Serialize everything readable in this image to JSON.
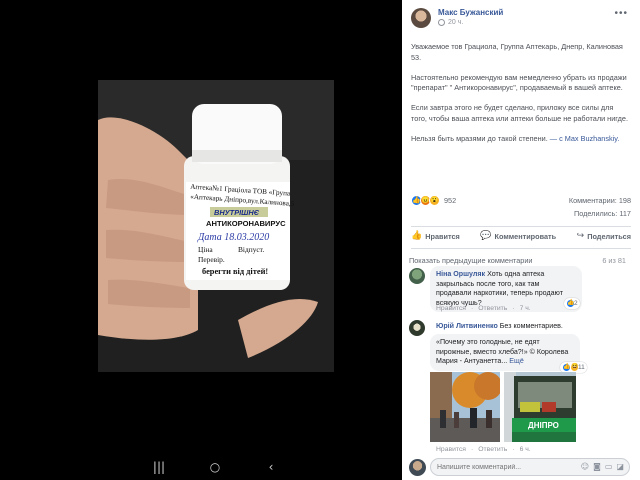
{
  "photo": {
    "label_lines": [
      "Аптека№1 Граціола ТОВ «Група",
      "«Аптекарь Дніпро,вул.Калинова,5",
      "ВНУТРІШНЄ",
      "АНТИКОРОНАВИРУС",
      "Дата 18.03.2020",
      "Ціна",
      "Відпуст.",
      "Перевір.",
      "берегти від дітей!"
    ]
  },
  "android_nav": {
    "recent": "|||",
    "home": "○",
    "back": "‹"
  },
  "post": {
    "author": "Макс Бужанский",
    "time": "20 ч.",
    "more": "•••",
    "paragraphs": [
      "Уважаемое тов Грациола, Группа Аптекарь, Днепр, Калиновая 53.",
      "Настоятельно рекомендую вам немедленно убрать из продажи \"препарат\" \" Антикоронавирус\", продаваемый в вашей аптеке.",
      "Если завтра этого не будет сделано, приложу все силы для того, чтобы ваша аптека или аптеки больше не работали нигде."
    ],
    "last_paragraph": "Нельзя быть мразями до такой степени.",
    "last_paragraph_link": " — с Max Buzhanskiy.",
    "reactions_count": "952",
    "comments_count": "Комментарии: 198",
    "shares_count": "Поделились: 117",
    "actions": {
      "like": "Нравится",
      "comment": "Комментировать",
      "share": "Поделиться"
    },
    "prev_comments": "Показать предыдущие комментарии",
    "comment_counter": "6 из 81"
  },
  "comments": [
    {
      "name": "Ніна Оршуляк",
      "text": "Хоть одна аптека закрыльась после того, как там продавали наркотики, теперь продают всякую чушь?",
      "reactions": "2",
      "like": "Нравится",
      "reply": "Ответить",
      "time": "7 ч."
    },
    {
      "name": "Юрій Литвиненко",
      "text": "Без комментариев.",
      "quote": "«Почему это голодные, не едят пирожные, вместо хлеба?!» © Королева Мария - Антуанетта...",
      "more": "Ещё",
      "reactions": "11",
      "like": "Нравится",
      "reply": "Ответить",
      "time": "6 ч.",
      "bus_sign": "ДНІПРО"
    }
  ],
  "comment_input": {
    "placeholder": "Напишите комментарий..."
  }
}
